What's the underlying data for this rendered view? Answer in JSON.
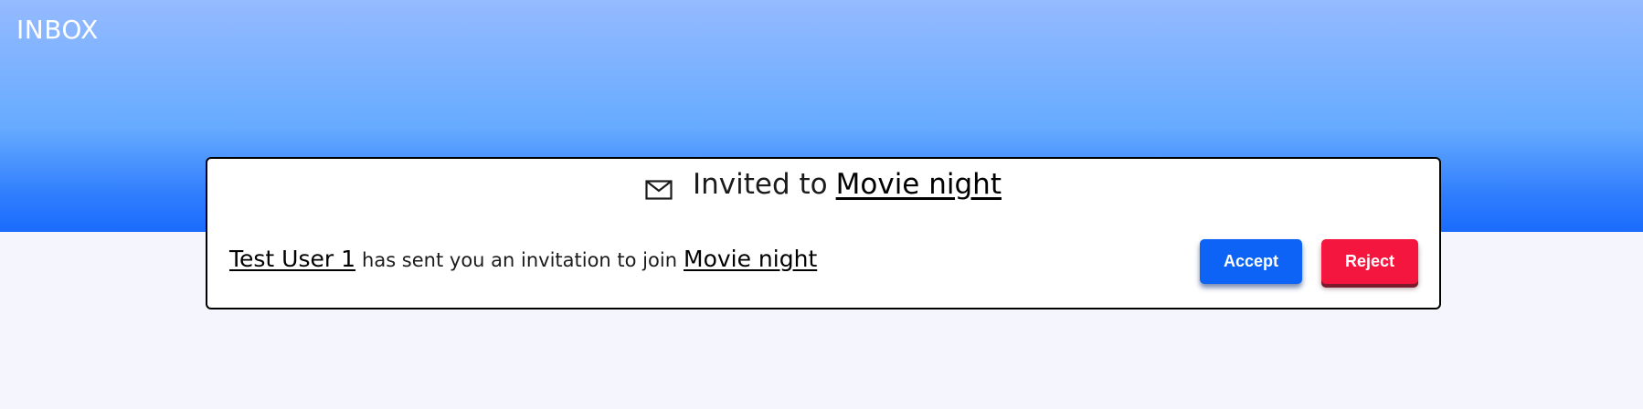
{
  "header": {
    "title": "INBOX"
  },
  "invitation": {
    "title_prefix": "Invited to",
    "event_name": "Movie night",
    "sender": "Test User 1",
    "message": "has sent you an invitation to join",
    "accept_label": "Accept",
    "reject_label": "Reject"
  },
  "icons": {
    "mail": "envelope-icon"
  },
  "colors": {
    "accent": "#0d63f5",
    "danger": "#f5163f",
    "header_gradient_top": "#95baff",
    "header_gradient_bottom": "#1a6bfd",
    "background": "#f5f6fd"
  }
}
